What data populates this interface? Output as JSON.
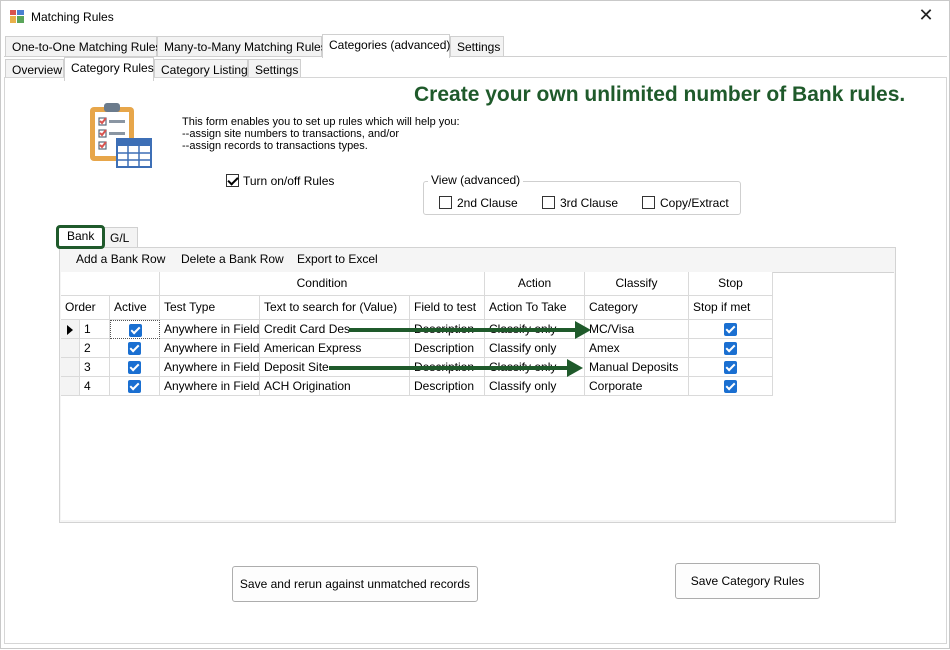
{
  "window": {
    "title": "Matching Rules",
    "close_glyph": "✕"
  },
  "main_tabs": [
    {
      "label": "One-to-One Matching Rules"
    },
    {
      "label": "Many-to-Many Matching Rules"
    },
    {
      "label": "Categories (advanced)"
    },
    {
      "label": "Settings"
    }
  ],
  "sub_tabs": [
    {
      "label": "Overview"
    },
    {
      "label": "Category Rules"
    },
    {
      "label": "Category Listing"
    },
    {
      "label": "Settings"
    }
  ],
  "headline": "Create your own unlimited number of Bank rules.",
  "description": {
    "line1": "This form enables you to set up rules which will help you:",
    "line2": "--assign site numbers to transactions, and/or",
    "line3": "--assign records to transactions types."
  },
  "turn_rules": {
    "label": "Turn on/off Rules",
    "checked": true
  },
  "view_advanced": {
    "legend": "View (advanced)",
    "options": [
      {
        "label": "2nd Clause",
        "checked": false
      },
      {
        "label": "3rd Clause",
        "checked": false
      },
      {
        "label": "Copy/Extract",
        "checked": false
      }
    ]
  },
  "rule_tabs": [
    {
      "label": "Bank"
    },
    {
      "label": "G/L"
    }
  ],
  "toolbar": {
    "add": "Add a Bank Row",
    "delete": "Delete a Bank Row",
    "export": "Export to Excel"
  },
  "grid": {
    "groups": {
      "condition": "Condition",
      "action": "Action",
      "classify": "Classify",
      "stop": "Stop"
    },
    "columns": [
      "Order",
      "Active",
      "Test Type",
      "Text to search for (Value)",
      "Field to test",
      "Action To Take",
      "Category",
      "Stop if met"
    ],
    "rows": [
      {
        "order": "1",
        "active": true,
        "test_type": "Anywhere in Field",
        "text": "Credit Card Des",
        "field": "Description",
        "action": "Classify only",
        "category": "MC/Visa",
        "stop": true
      },
      {
        "order": "2",
        "active": true,
        "test_type": "Anywhere in Field",
        "text": "American Express",
        "field": "Description",
        "action": "Classify only",
        "category": "Amex",
        "stop": true
      },
      {
        "order": "3",
        "active": true,
        "test_type": "Anywhere in Field",
        "text": "Deposit Site",
        "field": "Description",
        "action": "Classify only",
        "category": "Manual Deposits",
        "stop": true
      },
      {
        "order": "4",
        "active": true,
        "test_type": "Anywhere in Field",
        "text": "ACH Origination",
        "field": "Description",
        "action": "Classify only",
        "category": "Corporate",
        "stop": true
      }
    ]
  },
  "buttons": {
    "rerun": "Save and rerun against unmatched records",
    "save": "Save Category Rules"
  },
  "colors": {
    "accent_green": "#1f5a2b",
    "checkbox_blue": "#1a6fd1"
  }
}
